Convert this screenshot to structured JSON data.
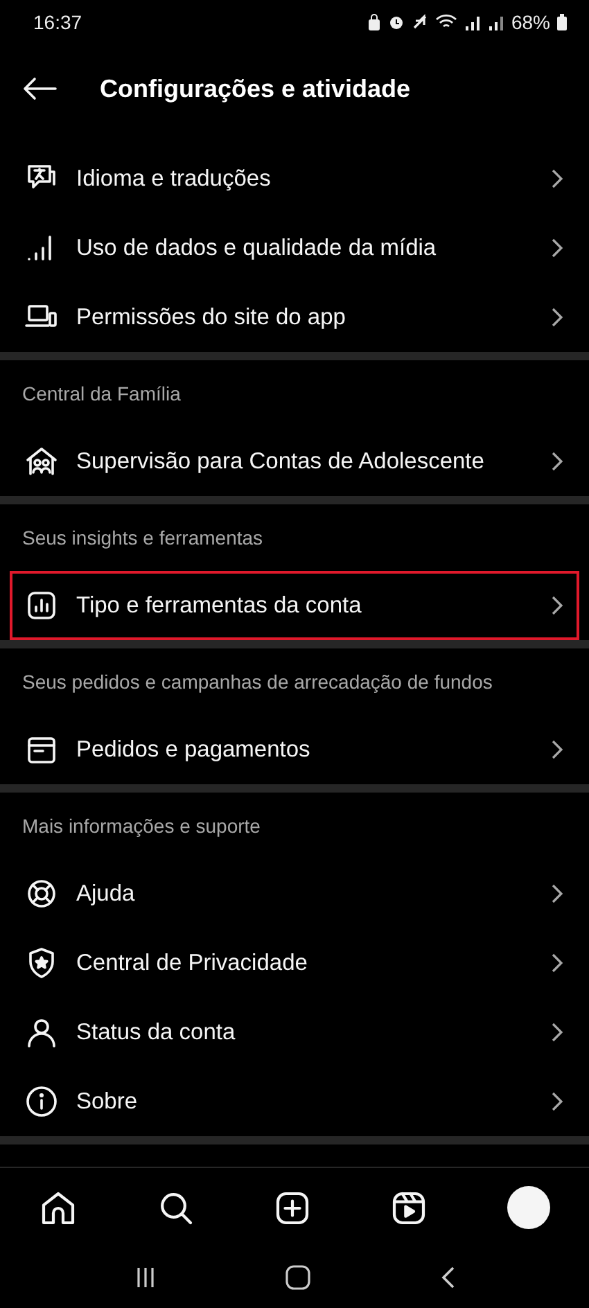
{
  "status_bar": {
    "time": "16:37",
    "battery": "68%"
  },
  "header": {
    "title": "Configurações e atividade"
  },
  "sections": [
    {
      "items": [
        {
          "label": "Idioma e traduções",
          "highlighted": false
        },
        {
          "label": "Uso de dados e qualidade da mídia",
          "highlighted": false
        },
        {
          "label": "Permissões do site do app",
          "highlighted": false
        }
      ]
    },
    {
      "title": "Central da Família",
      "items": [
        {
          "label": "Supervisão para Contas de Adolescente",
          "highlighted": false
        }
      ]
    },
    {
      "title": "Seus insights e ferramentas",
      "items": [
        {
          "label": "Tipo e ferramentas da conta",
          "highlighted": true
        }
      ]
    },
    {
      "title": "Seus pedidos e campanhas de arrecadação de fundos",
      "items": [
        {
          "label": "Pedidos e pagamentos",
          "highlighted": false
        }
      ]
    },
    {
      "title": "Mais informações e suporte",
      "items": [
        {
          "label": "Ajuda",
          "highlighted": false
        },
        {
          "label": "Central de Privacidade",
          "highlighted": false
        },
        {
          "label": "Status da conta",
          "highlighted": false
        },
        {
          "label": "Sobre",
          "highlighted": false
        }
      ]
    }
  ]
}
